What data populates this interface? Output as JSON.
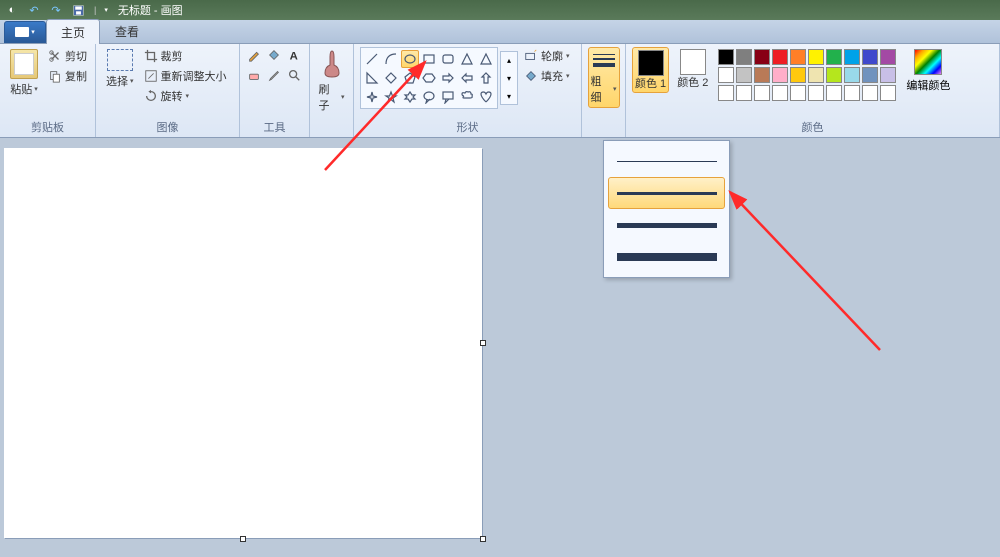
{
  "titlebar": {
    "title": "无标题 - 画图"
  },
  "tabs": {
    "home": "主页",
    "view": "查看"
  },
  "groups": {
    "clipboard": {
      "label": "剪贴板",
      "paste": "粘贴",
      "cut": "剪切",
      "copy": "复制"
    },
    "image": {
      "label": "图像",
      "select": "选择",
      "crop": "裁剪",
      "resize": "重新调整大小",
      "rotate": "旋转"
    },
    "tools": {
      "label": "工具",
      "brushes": "刷子"
    },
    "shapes": {
      "label": "形状",
      "outline": "轮廓",
      "fill": "填充"
    },
    "size": {
      "label": "粗细"
    },
    "colors": {
      "label": "颜色",
      "color1": "颜色 1",
      "color2": "颜色 2",
      "edit": "编辑颜色"
    }
  },
  "palette_row1": [
    "#000000",
    "#7f7f7f",
    "#880015",
    "#ed1c24",
    "#ff7f27",
    "#fff200",
    "#22b14c",
    "#00a2e8",
    "#3f48cc",
    "#a349a4"
  ],
  "palette_row2": [
    "#ffffff",
    "#c3c3c3",
    "#b97a57",
    "#ffaec9",
    "#ffc90e",
    "#efe4b0",
    "#b5e61d",
    "#99d9ea",
    "#7092be",
    "#c8bfe7"
  ],
  "palette_row3": [
    "#ffffff",
    "#ffffff",
    "#ffffff",
    "#ffffff",
    "#ffffff",
    "#ffffff",
    "#ffffff",
    "#ffffff",
    "#ffffff",
    "#ffffff"
  ],
  "color1_value": "#000000",
  "color2_value": "#ffffff",
  "size_options": [
    1,
    3,
    5,
    8
  ],
  "size_selected_index": 1
}
